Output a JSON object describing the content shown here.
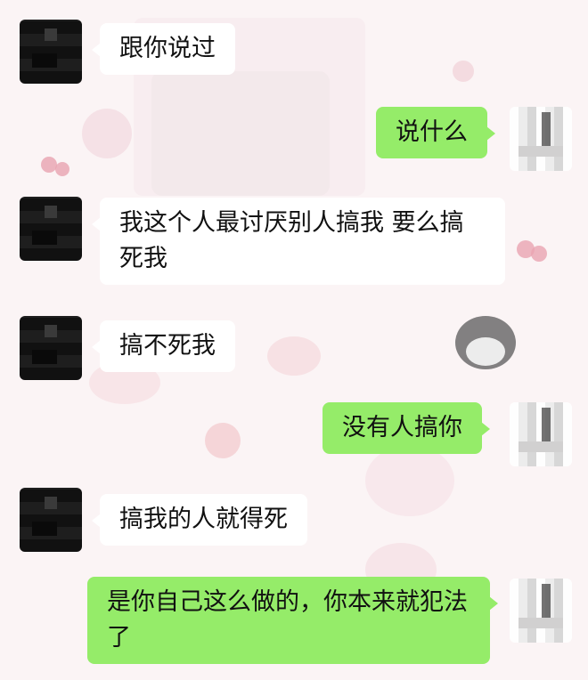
{
  "messages": [
    {
      "side": "in",
      "text": "跟你说过"
    },
    {
      "side": "out",
      "text": "说什么"
    },
    {
      "side": "in",
      "text": "我这个人最讨厌别人搞我 要么搞死我"
    },
    {
      "side": "in",
      "text": "搞不死我"
    },
    {
      "side": "out",
      "text": "没有人搞你"
    },
    {
      "side": "in",
      "text": "搞我的人就得死"
    },
    {
      "side": "out",
      "text": "是你自己这么做的，你本来就犯法了"
    }
  ],
  "colors": {
    "incoming_bubble": "#ffffff",
    "outgoing_bubble": "#95ec69",
    "background": "#fbf4f5"
  }
}
